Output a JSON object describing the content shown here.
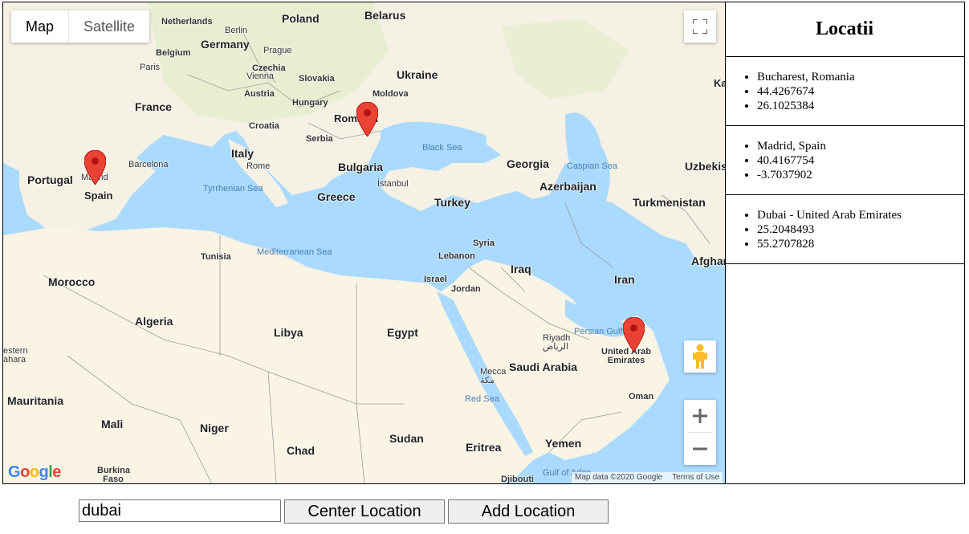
{
  "map": {
    "type_buttons": [
      "Map",
      "Satellite"
    ],
    "countries": [
      "Netherlands",
      "Poland",
      "Belarus",
      "Germany",
      "Belgium",
      "Czechia",
      "Slovakia",
      "Ukraine",
      "Moldova",
      "Austria",
      "Hungary",
      "France",
      "Croatia",
      "Romania",
      "Serbia",
      "Italy",
      "Bulgaria",
      "Georgia",
      "Portugal",
      "Spain",
      "Greece",
      "Turkey",
      "Azerbaijan",
      "Turkmenistan",
      "Uzbekis",
      "Syria",
      "Lebanon",
      "Iraq",
      "Israel",
      "Jordan",
      "Afghan",
      "Iran",
      "Tunisia",
      "Morocco",
      "Algeria",
      "Libya",
      "Egypt",
      "Saudi Arabia",
      "United Arab Emirates",
      "Oman",
      "Mauritania",
      "Mali",
      "Niger",
      "Chad",
      "Sudan",
      "Eritrea",
      "Yemen",
      "Burkina Faso",
      "Djibouti",
      "Ka",
      "estern ahara"
    ],
    "cities": [
      "Berlin",
      "Prague",
      "Paris",
      "Vienna",
      "Barcelona",
      "Madrid",
      "Rome",
      "İstanbul",
      "Riyadh الرياض",
      "Mecca مكة"
    ],
    "seas": [
      "Black Sea",
      "Caspian Sea",
      "Tyrrhenian Sea",
      "Mediterranean Sea",
      "Persian Gulf",
      "Red Sea",
      "Gulf of Aden"
    ],
    "attribution": [
      "Map data ©2020 Google",
      "Terms of Use"
    ],
    "logo": "Google",
    "marker_color": "#ea4335"
  },
  "panel": {
    "title": "Locatii",
    "locations": [
      {
        "name": "Bucharest, Romania",
        "lat": "44.4267674",
        "lng": "26.1025384"
      },
      {
        "name": "Madrid, Spain",
        "lat": "40.4167754",
        "lng": "-3.7037902"
      },
      {
        "name": "Dubai - United Arab Emirates",
        "lat": "25.2048493",
        "lng": "55.2707828"
      }
    ]
  },
  "controls": {
    "search_value": "dubai",
    "center_label": "Center Location",
    "add_label": "Add Location"
  }
}
